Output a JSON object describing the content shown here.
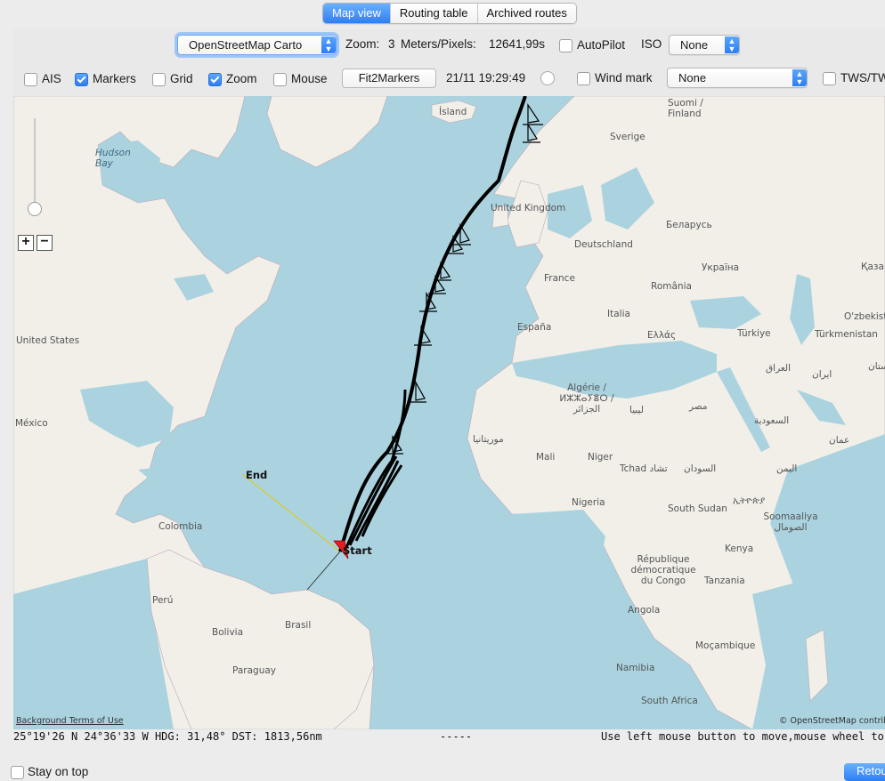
{
  "tabs": [
    {
      "label": "Map view",
      "active": true
    },
    {
      "label": "Routing table",
      "active": false
    },
    {
      "label": "Archived routes",
      "active": false
    }
  ],
  "toolbar": {
    "tile_source": "OpenStreetMap Carto",
    "zoom_label": "Zoom:",
    "zoom_value": "3",
    "meters_label": "Meters/Pixels:",
    "meters_value": "12641,99s",
    "autopilot_label": "AutoPilot",
    "autopilot_checked": false,
    "iso_label": "ISO",
    "iso_value": "None",
    "ais_label": "AIS",
    "ais_checked": false,
    "markers_label": "Markers",
    "markers_checked": true,
    "grid_label": "Grid",
    "grid_checked": false,
    "zoom_check_label": "Zoom",
    "zoom_checked": true,
    "mouse_label": "Mouse",
    "mouse_checked": false,
    "fit_button": "Fit2Markers",
    "datetime": "21/11 19:29:49",
    "wind_mark_label": "Wind mark",
    "wind_mark_checked": false,
    "wind_value": "None",
    "tws_label": "TWS/TWA"
  },
  "map": {
    "labels": {
      "island": "Ísland",
      "finland": "Suomi / Finland",
      "sverige": "Sverige",
      "hudson": "Hudson Bay",
      "uk": "United Kingdom",
      "belarus": "Беларусь",
      "deutschland": "Deutschland",
      "ukraine": "Україна",
      "kazakh": "Қаза",
      "france": "France",
      "romania": "România",
      "italia": "Italia",
      "espana": "España",
      "ellas": "Ελλάς",
      "turkiye": "Türkiye",
      "uzbek": "O'zbekist",
      "turkmen": "Türkmenistan",
      "usa": "United States",
      "algerie": "Algérie / ⵍⵣⵣⴰⵢⴻⵔ / الجزائر",
      "libya": "ليبيا",
      "misr": "مصر",
      "iraq": "العراق",
      "iran": "ایران",
      "saudi": "السعودية",
      "oman": "عمان",
      "mexico": "México",
      "mauritania": "موريتانيا",
      "mali": "Mali",
      "niger": "Niger",
      "tchad": "Tchad تشاد",
      "sudan": "السودان",
      "yemen": "اليمن",
      "nigeria": "Nigeria",
      "ssudan": "South Sudan",
      "ethiopia": "ኢትዮጵያ",
      "somalia": "Soomaaliya الصومال",
      "colombia": "Colombia",
      "kenya": "Kenya",
      "rdc": "République démocratique du Congo",
      "tanzania": "Tanzania",
      "peru": "Perú",
      "brasil": "Brasil",
      "angola": "Angola",
      "bolivia": "Bolivia",
      "mocambique": "Moçambique",
      "paraguay": "Paraguay",
      "namibia": "Namibia",
      "safrica": "South Africa",
      "pakistan": "پاکستان"
    },
    "end_label": "End",
    "start_label": "Start",
    "background_terms": "Background Terms of Use",
    "attribution": "© OpenStreetMap contributors"
  },
  "status": {
    "position": "25°19'26 N 24°36'33 W HDG: 31,48° DST: 1813,56nm",
    "separator": "-----",
    "hint": "Use left mouse button to move,mouse wheel to zoom"
  },
  "footer": {
    "stay_on_top": "Stay on top",
    "retour": "Retour"
  },
  "colors": {
    "sea": "#aad3df",
    "land": "#f2efe9",
    "accent": "#2d7ff5",
    "route": "#000000",
    "end_line": "#e6c800",
    "start_marker": "#e02020"
  }
}
